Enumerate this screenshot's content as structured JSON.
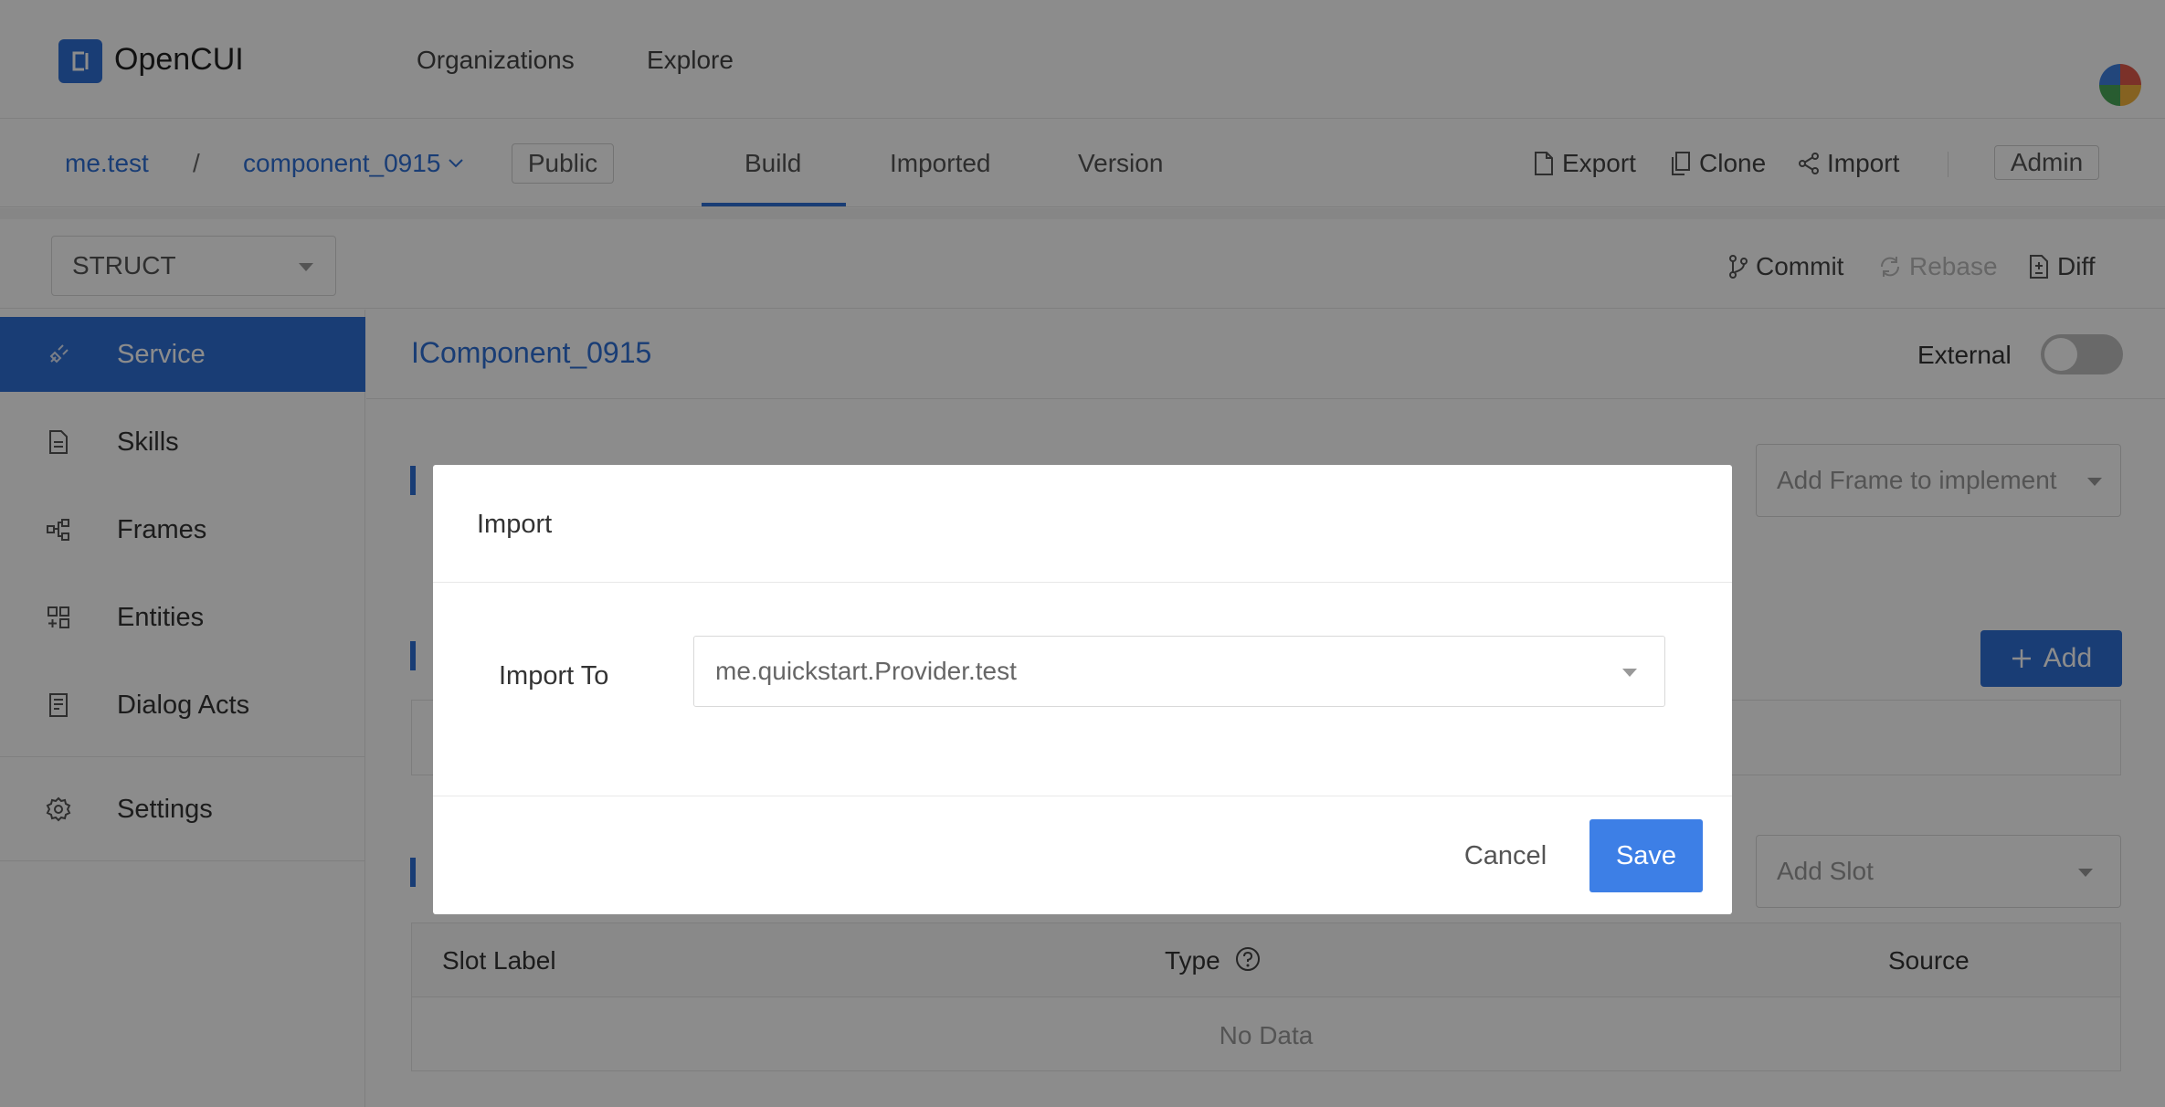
{
  "brand": {
    "name": "OpenCUI"
  },
  "topnav": {
    "organizations": "Organizations",
    "explore": "Explore"
  },
  "subnav": {
    "org": "me.test",
    "separator": "/",
    "project": "component_0915",
    "visibility": "Public",
    "tabs": [
      "Build",
      "Imported",
      "Version"
    ],
    "actions": {
      "export": "Export",
      "clone": "Clone",
      "import": "Import"
    },
    "role": "Admin"
  },
  "toolbar": {
    "type_select": "STRUCT",
    "commit": "Commit",
    "rebase": "Rebase",
    "diff": "Diff"
  },
  "sidebar": {
    "items": [
      {
        "label": "Service",
        "icon": "plug-icon",
        "active": true
      },
      {
        "label": "Skills",
        "icon": "document-icon",
        "active": false
      },
      {
        "label": "Frames",
        "icon": "frames-icon",
        "active": false
      },
      {
        "label": "Entities",
        "icon": "entities-icon",
        "active": false
      },
      {
        "label": "Dialog Acts",
        "icon": "dialog-acts-icon",
        "active": false
      }
    ],
    "settings": {
      "label": "Settings",
      "icon": "gear-icon"
    }
  },
  "main": {
    "title": "IComponent_0915",
    "external_label": "External",
    "external_on": false,
    "add_frame_placeholder": "Add Frame to implement",
    "add_button": "Add",
    "add_slot_placeholder": "Add Slot",
    "table": {
      "columns": [
        "Slot Label",
        "Type",
        "Source"
      ],
      "empty_text": "No Data"
    }
  },
  "modal": {
    "title": "Import",
    "field_label": "Import To",
    "field_value": "me.quickstart.Provider.test",
    "cancel": "Cancel",
    "save": "Save"
  },
  "colors": {
    "accent": "#2f6fd6",
    "save": "#3d7fe6"
  }
}
